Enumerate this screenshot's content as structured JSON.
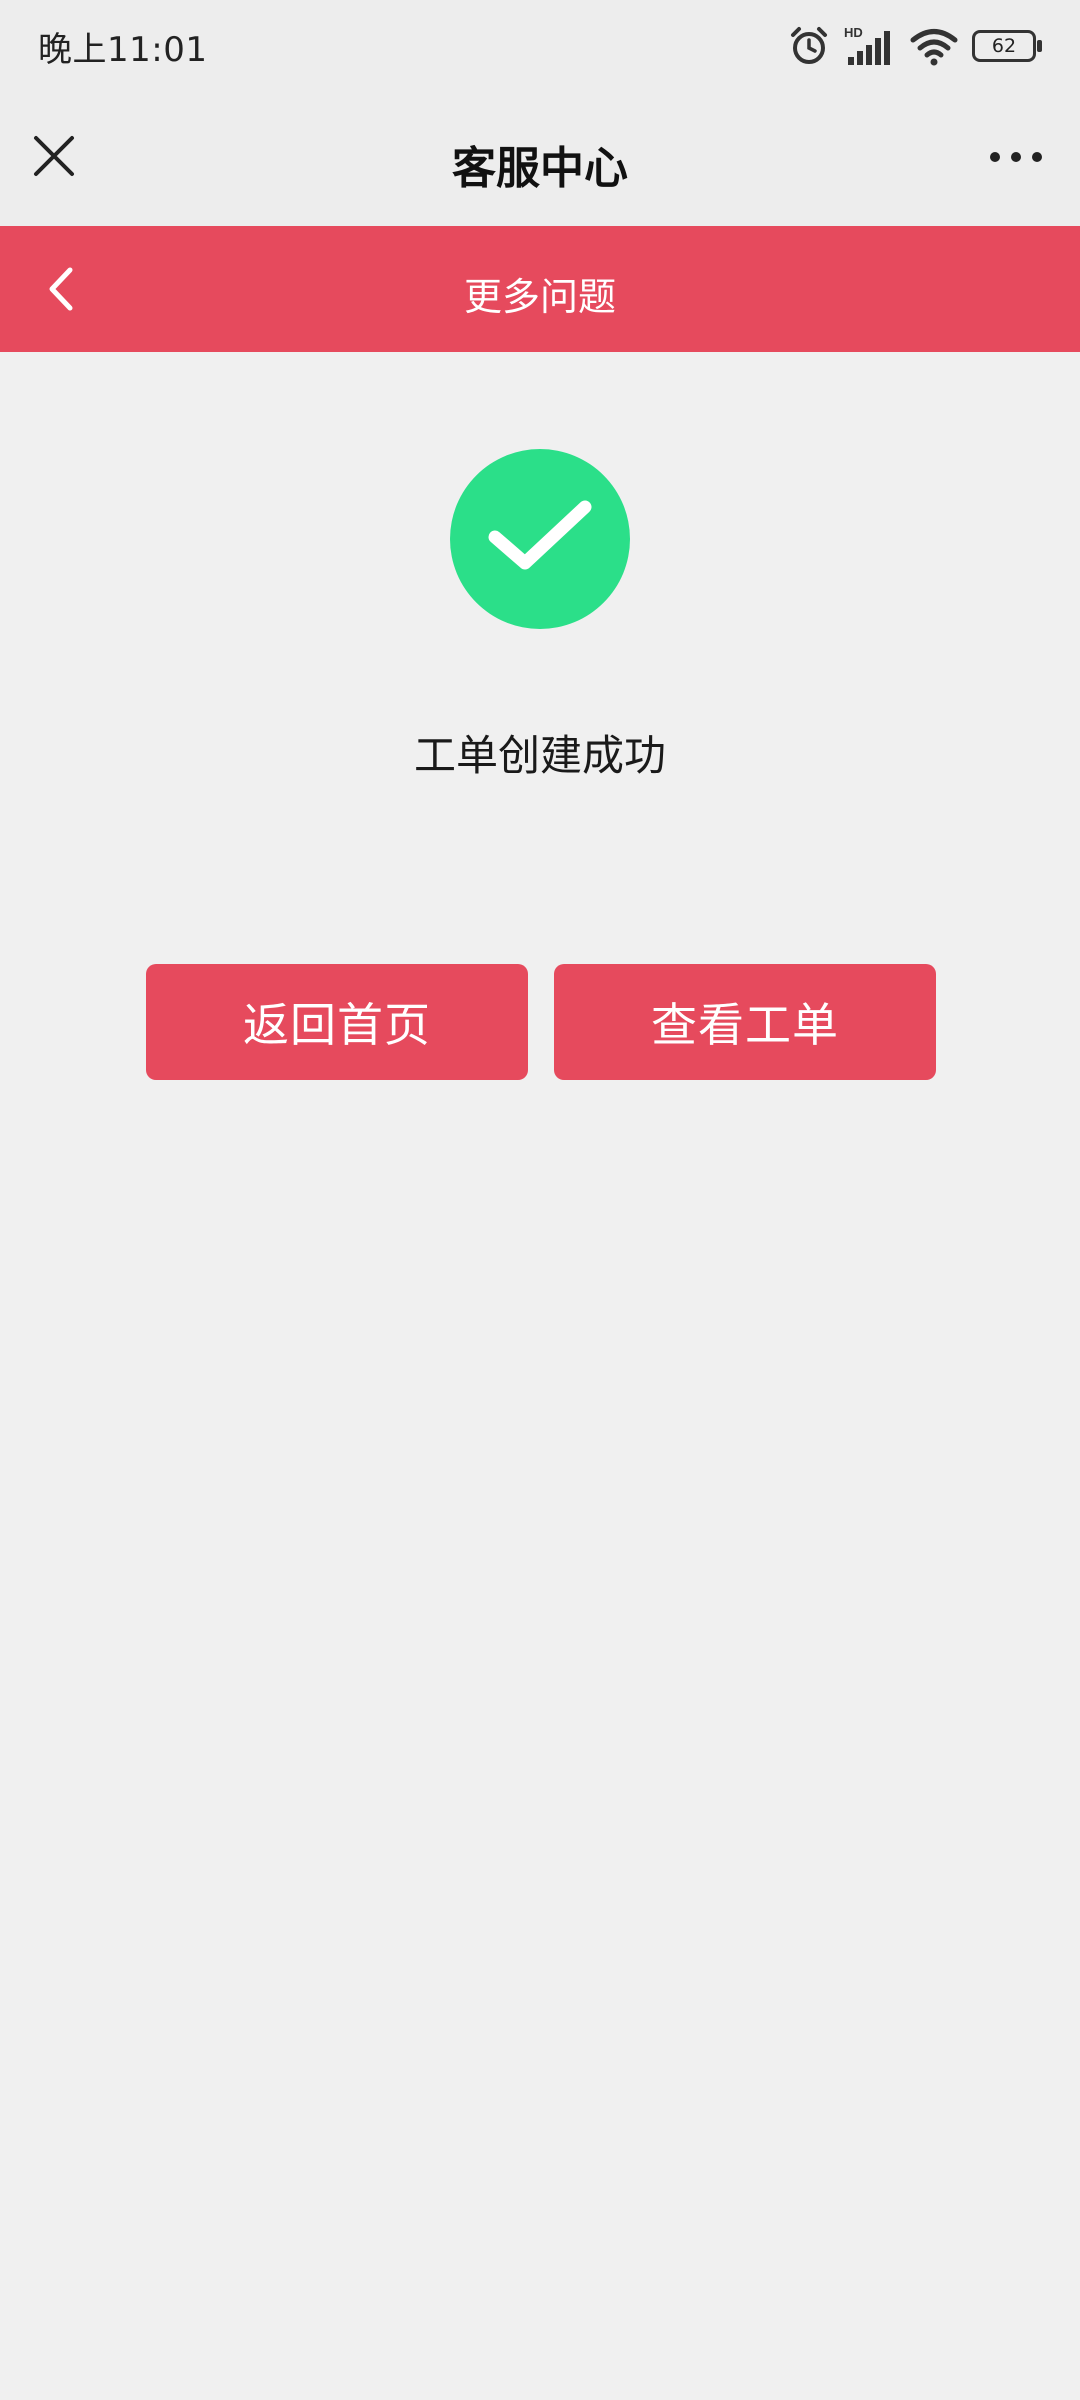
{
  "status_bar": {
    "time": "晚上11:01",
    "network_label": "HD",
    "battery": "62",
    "icons": [
      "alarm-icon",
      "signal-icon",
      "wifi-icon",
      "battery-icon"
    ]
  },
  "header": {
    "title": "客服中心",
    "close_icon": "close-icon",
    "more_icon": "more-icon"
  },
  "sub_header": {
    "title": "更多问题",
    "back_icon": "chevron-left-icon"
  },
  "result": {
    "icon": "check-circle-icon",
    "message": "工单创建成功"
  },
  "actions": {
    "home_label": "返回首页",
    "view_label": "查看工单"
  },
  "colors": {
    "accent": "#e64a5d",
    "success": "#2bdf89",
    "background": "#f0f0f0",
    "header_bg": "#ededed"
  }
}
